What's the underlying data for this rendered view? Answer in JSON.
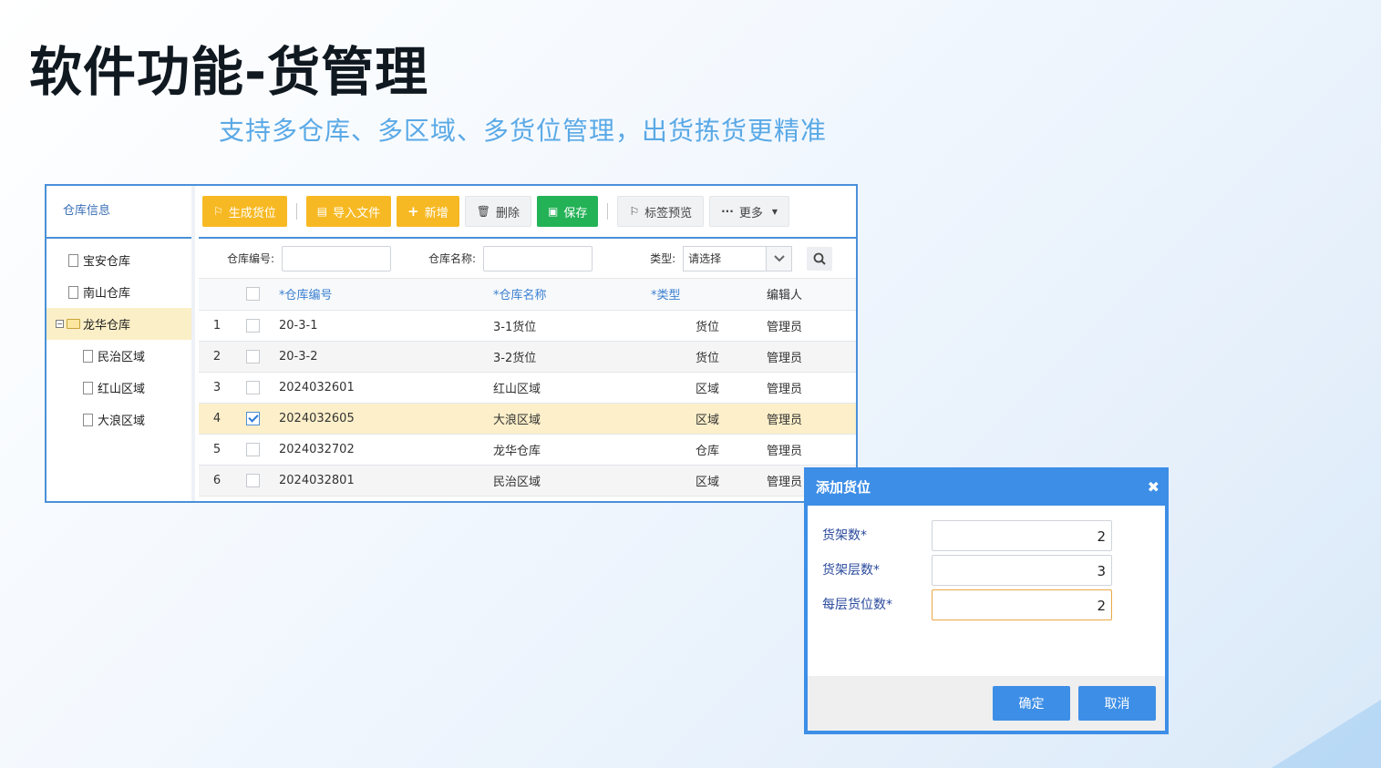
{
  "page": {
    "title": "软件功能-货管理",
    "subtitle": "支持多仓库、多区域、多货位管理，出货拣货更精准"
  },
  "sidebar": {
    "header": "仓库信息",
    "items": [
      {
        "label": "宝安仓库"
      },
      {
        "label": "南山仓库"
      },
      {
        "label": "龙华仓库",
        "expanded": true,
        "selected": true
      },
      {
        "label": "民治区域"
      },
      {
        "label": "红山区域"
      },
      {
        "label": "大浪区域"
      }
    ]
  },
  "toolbar": {
    "generate": "生成货位",
    "import": "导入文件",
    "add": "新增",
    "delete": "删除",
    "save": "保存",
    "label_preview": "标签预览",
    "more": "更多"
  },
  "filter": {
    "code_label": "仓库编号:",
    "name_label": "仓库名称:",
    "type_label": "类型:",
    "type_selected": "请选择"
  },
  "table": {
    "headers": {
      "code": "*仓库编号",
      "name": "*仓库名称",
      "type": "*类型",
      "editor": "编辑人"
    },
    "rows": [
      {
        "idx": "1",
        "code": "20-3-1",
        "name": "3-1货位",
        "type": "货位",
        "editor": "管理员"
      },
      {
        "idx": "2",
        "code": "20-3-2",
        "name": "3-2货位",
        "type": "货位",
        "editor": "管理员"
      },
      {
        "idx": "3",
        "code": "2024032601",
        "name": "红山区域",
        "type": "区域",
        "editor": "管理员"
      },
      {
        "idx": "4",
        "code": "2024032605",
        "name": "大浪区域",
        "type": "区域",
        "editor": "管理员"
      },
      {
        "idx": "5",
        "code": "2024032702",
        "name": "龙华仓库",
        "type": "仓库",
        "editor": "管理员"
      },
      {
        "idx": "6",
        "code": "2024032801",
        "name": "民治区域",
        "type": "区域",
        "editor": "管理员"
      }
    ]
  },
  "dialog": {
    "title": "添加货位",
    "fields": [
      {
        "label": "货架数*",
        "value": "2"
      },
      {
        "label": "货架层数*",
        "value": "3"
      },
      {
        "label": "每层货位数*",
        "value": "2"
      }
    ],
    "confirm": "确定",
    "cancel": "取消"
  },
  "colors": {
    "accent": "#3d8ee6",
    "warning": "#f7b923",
    "success": "#23b256",
    "subtitle": "#5aa9e6"
  }
}
